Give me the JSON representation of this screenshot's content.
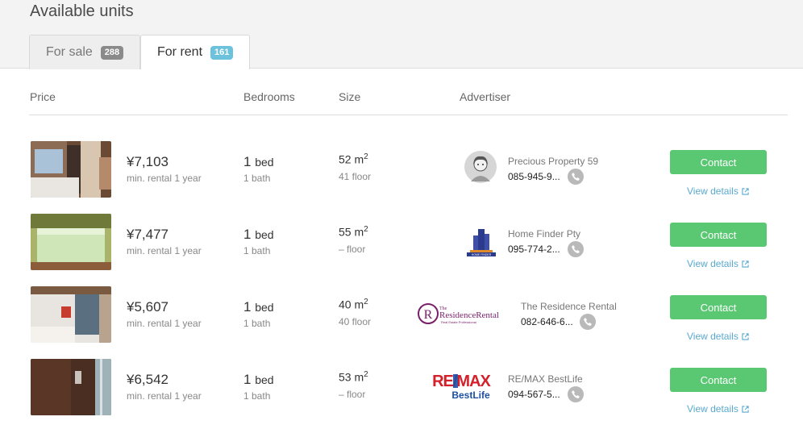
{
  "page_title": "Available units",
  "tabs": [
    {
      "label": "For sale",
      "count": "288",
      "active": false
    },
    {
      "label": "For rent",
      "count": "161",
      "active": true
    }
  ],
  "columns": {
    "price": "Price",
    "bedrooms": "Bedrooms",
    "size": "Size",
    "advertiser": "Advertiser"
  },
  "colors": {
    "contact_button": "#5ac873",
    "badge_rent": "#6cc1dd",
    "badge_sale": "#8a8a8a",
    "link": "#5aa9cf"
  },
  "listings": [
    {
      "price": "¥7,103",
      "min_rental": "min. rental 1 year",
      "bed_count": "1",
      "bed_unit": "bed",
      "bath": "1 bath",
      "size": "52 m",
      "size_sup": "2",
      "floor": "41 floor",
      "advertiser": "Precious Property 59",
      "phone": "085-945-9...",
      "contact": "Contact",
      "view_details": "View details",
      "logo": "avatar-icon"
    },
    {
      "price": "¥7,477",
      "min_rental": "min. rental 1 year",
      "bed_count": "1",
      "bed_unit": "bed",
      "bath": "1 bath",
      "size": "55 m",
      "size_sup": "2",
      "floor": "– floor",
      "advertiser": "Home Finder Pty",
      "phone": "095-774-2...",
      "contact": "Contact",
      "view_details": "View details",
      "logo": "homefinder-logo",
      "logo_text": "HOME FINDER"
    },
    {
      "price": "¥5,607",
      "min_rental": "min. rental 1 year",
      "bed_count": "1",
      "bed_unit": "bed",
      "bath": "1 bath",
      "size": "40 m",
      "size_sup": "2",
      "floor": "40 floor",
      "advertiser": "The Residence Rental",
      "phone": "082-646-6...",
      "contact": "Contact",
      "view_details": "View details",
      "logo": "residence-rental-logo",
      "logo_text": "The ResidenceRental Real Estate Professional"
    },
    {
      "price": "¥6,542",
      "min_rental": "min. rental 1 year",
      "bed_count": "1",
      "bed_unit": "bed",
      "bath": "1 bath",
      "size": "53 m",
      "size_sup": "2",
      "floor": "– floor",
      "advertiser": "RE/MAX BestLife",
      "phone": "094-567-5...",
      "contact": "Contact",
      "view_details": "View details",
      "logo": "remax-logo",
      "logo_text": "RE/MAX BestLife"
    }
  ]
}
